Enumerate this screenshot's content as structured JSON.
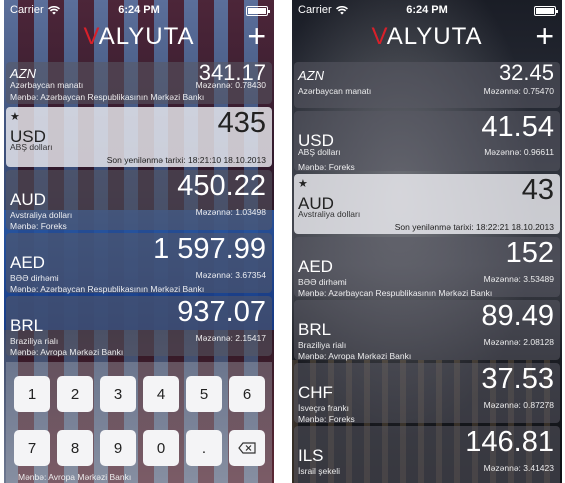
{
  "left": {
    "status": {
      "carrier": "Carrier",
      "time": "6:24 PM"
    },
    "logo": {
      "v": "V",
      "rest": "ALYUTA"
    },
    "add_label": "+",
    "rows": [
      {
        "code": "AZN",
        "value": "341.17",
        "name": "Azərbaycan manatı",
        "rate": "Məzənnə: 0.78430",
        "source": "Mənbə: Azərbaycan Respublikasının Mərkəzi Bankı"
      },
      {
        "code": "USD",
        "value": "435",
        "name": "ABŞ dolları",
        "updated": "Son yenilənmə tarixi: 18:21:10 18.10.2013",
        "starred": true
      },
      {
        "code": "AUD",
        "value": "450.22",
        "name": "Avstraliya dolları",
        "rate": "Məzənnə: 1.03498",
        "source": "Mənbə: Foreks"
      },
      {
        "code": "AED",
        "value": "1 597.99",
        "name": "BƏƏ dirhəmi",
        "rate": "Məzənnə: 3.67354",
        "source": "Mənbə: Azərbaycan Respublikasının Mərkəzi Bankı"
      },
      {
        "code": "BRL",
        "value": "937.07",
        "name": "Braziliya rialı",
        "rate": "Məzənnə: 2.15417",
        "source": "Mənbə: Avropa Mərkəzi Bankı"
      }
    ],
    "keypad": {
      "keys": [
        "1",
        "2",
        "3",
        "4",
        "5",
        "6",
        "7",
        "8",
        "9",
        "0",
        "."
      ],
      "bottom_source": "Mənbə: Avropa Mərkəzi Bankı"
    }
  },
  "right": {
    "status": {
      "carrier": "Carrier",
      "time": "6:24 PM"
    },
    "logo": {
      "v": "V",
      "rest": "ALYUTA"
    },
    "add_label": "+",
    "rows": [
      {
        "code": "AZN",
        "value": "32.45",
        "name": "Azərbaycan manatı",
        "rate": "Məzənnə: 0.75470"
      },
      {
        "code": "USD",
        "value": "41.54",
        "name": "ABŞ dolları",
        "rate": "Məzənnə: 0.96611",
        "source": "Mənbə: Foreks"
      },
      {
        "code": "AUD",
        "value": "43",
        "name": "Avstraliya dolları",
        "updated": "Son yenilənmə tarixi: 18:22:21 18.10.2013",
        "starred": true
      },
      {
        "code": "AED",
        "value": "152",
        "name": "BƏƏ dirhəmi",
        "rate": "Məzənnə: 3.53489",
        "source": "Mənbə: Azərbaycan Respublikasının Mərkəzi Bankı"
      },
      {
        "code": "BRL",
        "value": "89.49",
        "name": "Braziliya rialı",
        "rate": "Məzənnə: 2.08128",
        "source": "Mənbə: Avropa Mərkəzi Bankı"
      },
      {
        "code": "CHF",
        "value": "37.53",
        "name": "İsveçrə frankı",
        "rate": "Məzənnə: 0.87278",
        "source": "Mənbə: Foreks"
      },
      {
        "code": "ILS",
        "value": "146.81",
        "name": "İsrail şekeli",
        "rate": "Məzənnə: 3.41423"
      }
    ]
  },
  "colors": {
    "logo_accent": "#d8202a"
  },
  "icons": [
    "wifi-icon",
    "battery-icon",
    "star-icon",
    "add-icon",
    "backspace-icon"
  ]
}
